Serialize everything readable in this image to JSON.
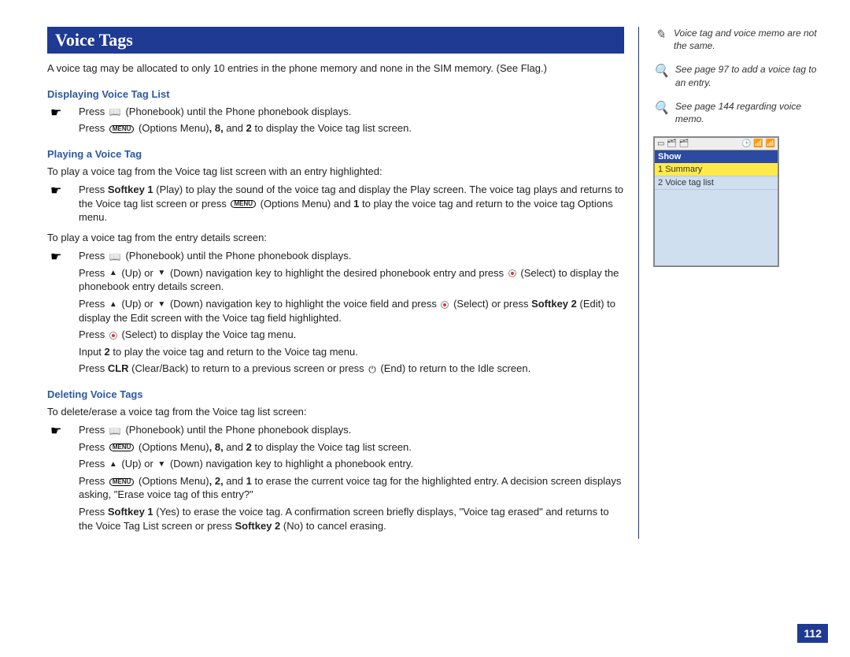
{
  "page": {
    "title": "Voice Tags",
    "intro": "A voice tag may be allocated to only 10 entries in the phone memory and none in the SIM memory. (See Flag.)",
    "pageNumber": "112"
  },
  "sections": {
    "s1": {
      "heading": "Displaying Voice Tag List",
      "steps": {
        "a": "Press",
        "a2": "(Phonebook) until the Phone phonebook displays.",
        "b1": "Press",
        "b2": "(Options Menu)",
        "b3": ", 8,",
        "b4": " and ",
        "b5": "2",
        "b6": " to display the Voice tag list screen."
      }
    },
    "s2": {
      "heading": "Playing a Voice Tag",
      "lead": "To play a voice tag from the Voice tag list screen with an entry highlighted:",
      "step1a": "Press ",
      "step1_sk1": "Softkey 1",
      "step1b": " (Play) to play the sound of the voice tag and display the Play screen. The voice tag plays and returns to the Voice tag list screen or press ",
      "step1c": " (Options Menu) and ",
      "step1_one": "1",
      "step1d": " to play the voice tag and return to the voice tag Options menu.",
      "lead2": "To play a voice tag from the entry details screen:",
      "d1": "Press",
      "d1b": "(Phonebook) until the Phone phonebook displays.",
      "d2a": "Press ",
      "d2b": " (Up) or ",
      "d2c": " (Down) navigation key to highlight the desired phonebook entry and press ",
      "d2d": " (Select) to display the phonebook entry details screen.",
      "d3a": "Press ",
      "d3b": " (Up) or ",
      "d3c": " (Down) navigation key to highlight the voice field and press ",
      "d3d": " (Select) or press ",
      "d3_sk2": "Softkey 2",
      "d3e": " (Edit) to display the Edit screen with the Voice tag field highlighted.",
      "d4a": "Press ",
      "d4b": " (Select) to display the Voice tag menu.",
      "d5a": "Input ",
      "d5_two": "2",
      "d5b": " to play the voice tag and return to the Voice tag menu.",
      "d6a": "Press ",
      "d6_clr": "CLR",
      "d6b": " (Clear/Back) to return to a previous screen or press ",
      "d6c": " (End) to return to the Idle screen."
    },
    "s3": {
      "heading": "Deleting Voice Tags",
      "lead": "To delete/erase a voice tag from the Voice tag list screen:",
      "e1a": "Press",
      "e1b": "(Phonebook) until the Phone phonebook displays.",
      "e2a": "Press ",
      "e2b": " (Options Menu)",
      "e2c": ", 8,",
      "e2d": " and ",
      "e2e": "2",
      "e2f": " to display the Voice tag list screen.",
      "e3a": "Press ",
      "e3b": " (Up) or ",
      "e3c": " (Down) navigation key to highlight a phonebook entry.",
      "e4a": "Press ",
      "e4b": " (Options Menu)",
      "e4c": ", 2,",
      "e4d": " and ",
      "e4e": "1",
      "e4f": " to erase the current voice tag for the highlighted entry. A decision screen displays asking, \"Erase voice tag of this entry?\"",
      "e5a": "Press ",
      "e5_sk1": "Softkey 1",
      "e5b": " (Yes) to erase the voice tag. A confirmation screen briefly displays, \"Voice tag erased\" and returns to the Voice Tag List screen or press ",
      "e5_sk2": "Softkey 2",
      "e5c": " (No) to cancel erasing."
    }
  },
  "sidebar": {
    "note1": "Voice tag and voice memo are not the same.",
    "note2": "See page 97 to add a voice tag to an entry.",
    "note3": "See page 144 regarding voice memo.",
    "phone": {
      "statusLeft": "▭ 🗂 🗂",
      "statusRight": "🕒 📶 📶",
      "headerTitle": "Show",
      "item1": "Summary",
      "item1_num": "1",
      "item2": "Voice tag list",
      "item2_num": "2"
    }
  },
  "labels": {
    "menu": "MENU"
  }
}
